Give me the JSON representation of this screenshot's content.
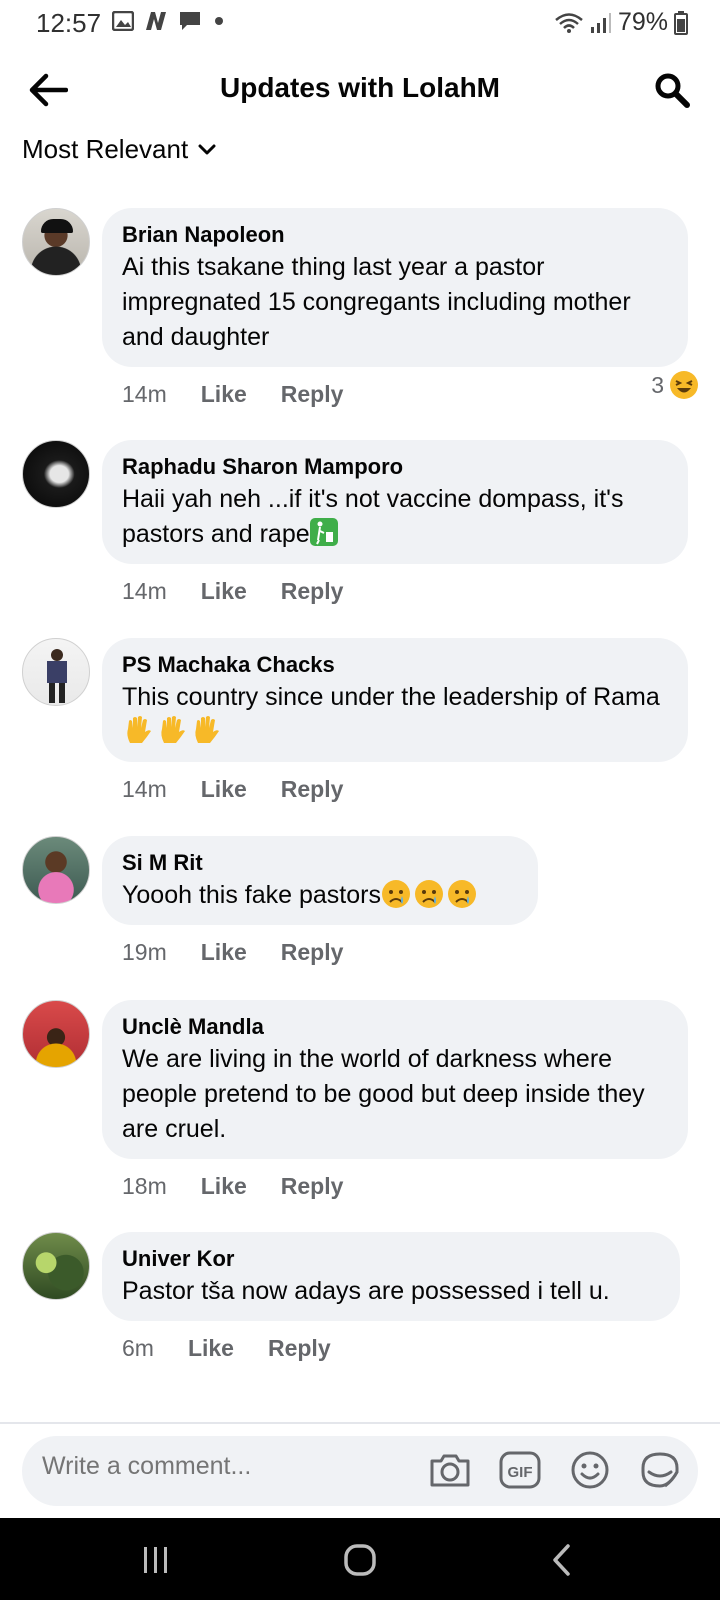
{
  "status_bar": {
    "time": "12:57",
    "battery": "79%"
  },
  "header": {
    "title": "Updates with LolahM"
  },
  "sort": {
    "label": "Most Relevant"
  },
  "comments": [
    {
      "author": "Brian Napoleon",
      "text": "Ai this tsakane thing last year a pastor impregnated 15 congregants including mother and daughter",
      "time": "14m",
      "like": "Like",
      "reply": "Reply",
      "reaction_count": "3"
    },
    {
      "author": "Raphadu Sharon Mamporo",
      "text": "Haii yah neh ...if it's not vaccine dompass, it's pastors and rape",
      "time": "14m",
      "like": "Like",
      "reply": "Reply"
    },
    {
      "author": "PS Machaka Chacks",
      "text": "This country since under the leadership of Rama",
      "time": "14m",
      "like": "Like",
      "reply": "Reply"
    },
    {
      "author": "Si M Rit",
      "text": "Yoooh this fake pastors",
      "time": "19m",
      "like": "Like",
      "reply": "Reply"
    },
    {
      "author": "Unclè Mandla",
      "text": "We are living in the world of darkness where people pretend to be good but deep inside they are cruel.",
      "time": "18m",
      "like": "Like",
      "reply": "Reply"
    },
    {
      "author": "Univer Kor",
      "text": "Pastor tša now adays are possessed i tell u.",
      "time": "6m",
      "like": "Like",
      "reply": "Reply"
    }
  ],
  "composer": {
    "placeholder": "Write a comment..."
  },
  "colors": {
    "bubble": "#f0f2f5",
    "meta_text": "#65676b",
    "text": "#050505"
  },
  "icons": [
    "back-arrow-icon",
    "search-icon",
    "chevron-down-icon",
    "camera-icon",
    "gif-icon",
    "smiley-icon",
    "sticker-icon",
    "recent-apps-icon",
    "home-icon",
    "nav-back-icon"
  ]
}
